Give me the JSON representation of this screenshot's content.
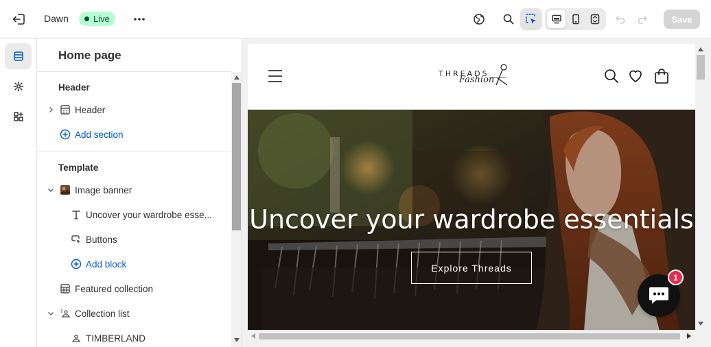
{
  "topbar": {
    "theme_name": "Dawn",
    "status": "Live",
    "save_label": "Save"
  },
  "sidebar": {
    "title": "Home page",
    "header_group": {
      "heading": "Header",
      "items": [
        {
          "label": "Header",
          "icon": "header-section-icon"
        }
      ],
      "add_label": "Add section"
    },
    "template_group": {
      "heading": "Template",
      "items": [
        {
          "label": "Image banner",
          "icon": "image-thumbnail-icon"
        },
        {
          "label": "Uncover your wardrobe esse...",
          "icon": "text-icon"
        },
        {
          "label": "Buttons",
          "icon": "button-icon"
        },
        {
          "label": "Add block",
          "icon": "plus-circle-icon"
        },
        {
          "label": "Featured collection",
          "icon": "featured-collection-icon"
        },
        {
          "label": "Collection list",
          "icon": "collection-list-icon"
        },
        {
          "label": "TIMBERLAND",
          "icon": "collection-icon"
        }
      ]
    }
  },
  "preview": {
    "logo_text": "THREADS",
    "logo_script": "Fashion",
    "banner_heading": "Uncover your wardrobe essentials",
    "banner_button": "Explore Threads",
    "chat_badge": "1"
  },
  "colors": {
    "accent_link": "#005bd3",
    "live_bg": "#b4fed2",
    "badge": "#e32c4f"
  }
}
